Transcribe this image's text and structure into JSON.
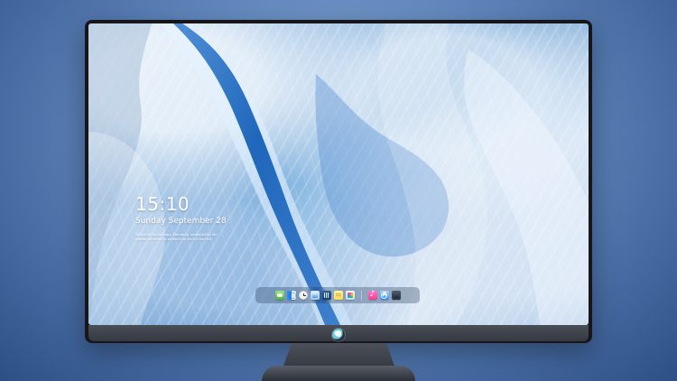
{
  "lock_screen": {
    "time": "15:10",
    "date": "Sunday September 28",
    "notification_line_1": "Welcome technology. Elevating productivity. No",
    "notification_line_2": "matter whether to explore for tech it can be"
  },
  "dock": {
    "items": [
      {
        "name": "messages",
        "icon": "messages-icon"
      },
      {
        "name": "finder",
        "icon": "finder-icon"
      },
      {
        "name": "clock",
        "icon": "clock-icon"
      },
      {
        "name": "preview",
        "icon": "preview-icon"
      },
      {
        "name": "video",
        "icon": "video-icon"
      },
      {
        "name": "notes",
        "icon": "notes-icon"
      },
      {
        "name": "photos",
        "icon": "photos-icon"
      },
      {
        "name": "music",
        "icon": "music-icon"
      },
      {
        "name": "app-store",
        "icon": "appstore-icon"
      },
      {
        "name": "terminal",
        "icon": "terminal-icon"
      }
    ]
  },
  "device": {
    "logo": "robot-logo"
  }
}
